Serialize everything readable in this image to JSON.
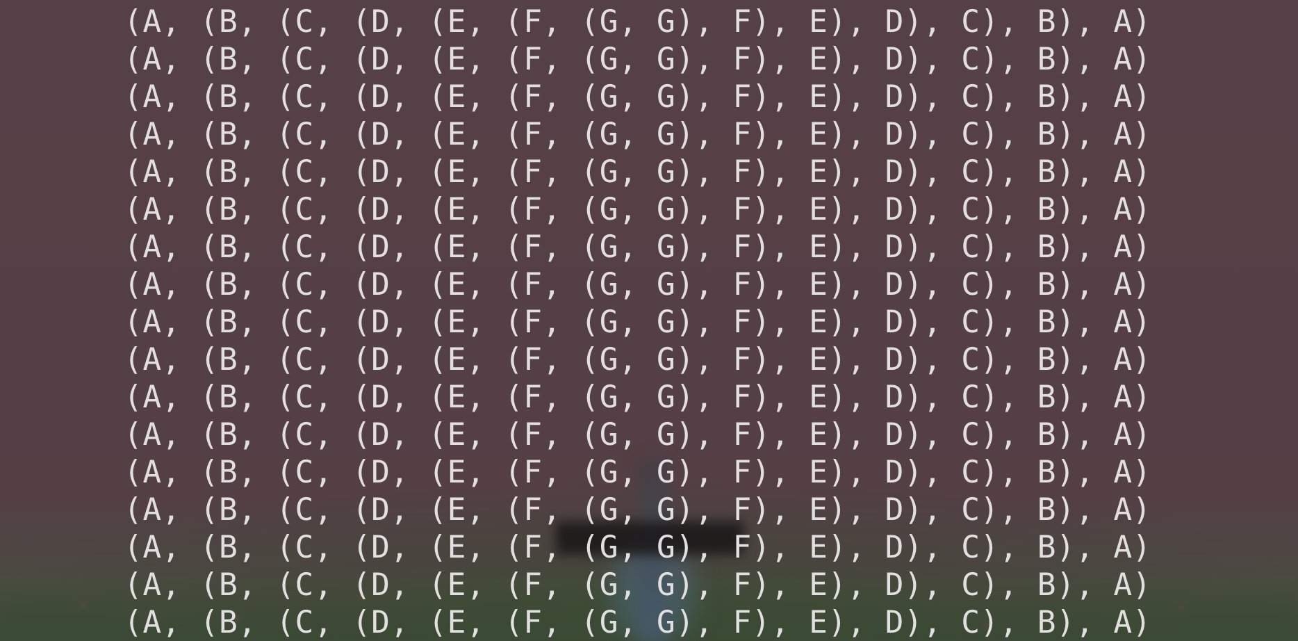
{
  "terminal": {
    "lines": [
      "(A, (B, (C, (D, (E, (F, (G, G), F), E), D), C), B), A)",
      "(A, (B, (C, (D, (E, (F, (G, G), F), E), D), C), B), A)",
      "(A, (B, (C, (D, (E, (F, (G, G), F), E), D), C), B), A)",
      "(A, (B, (C, (D, (E, (F, (G, G), F), E), D), C), B), A)",
      "(A, (B, (C, (D, (E, (F, (G, G), F), E), D), C), B), A)",
      "(A, (B, (C, (D, (E, (F, (G, G), F), E), D), C), B), A)",
      "(A, (B, (C, (D, (E, (F, (G, G), F), E), D), C), B), A)",
      "(A, (B, (C, (D, (E, (F, (G, G), F), E), D), C), B), A)",
      "(A, (B, (C, (D, (E, (F, (G, G), F), E), D), C), B), A)",
      "(A, (B, (C, (D, (E, (F, (G, G), F), E), D), C), B), A)",
      "(A, (B, (C, (D, (E, (F, (G, G), F), E), D), C), B), A)",
      "(A, (B, (C, (D, (E, (F, (G, G), F), E), D), C), B), A)",
      "(A, (B, (C, (D, (E, (F, (G, G), F), E), D), C), B), A)",
      "(A, (B, (C, (D, (E, (F, (G, G), F), E), D), C), B), A)",
      "(A, (B, (C, (D, (E, (F, (G, G), F), E), D), C), B), A)",
      "(A, (B, (C, (D, (E, (F, (G, G), F), E), D), C), B), A)",
      "(A, (B, (C, (D, (E, (F, (G, G), F), E), D), C), B), A)"
    ]
  },
  "colors": {
    "text": "#e2dfe0",
    "background": "#564047"
  }
}
